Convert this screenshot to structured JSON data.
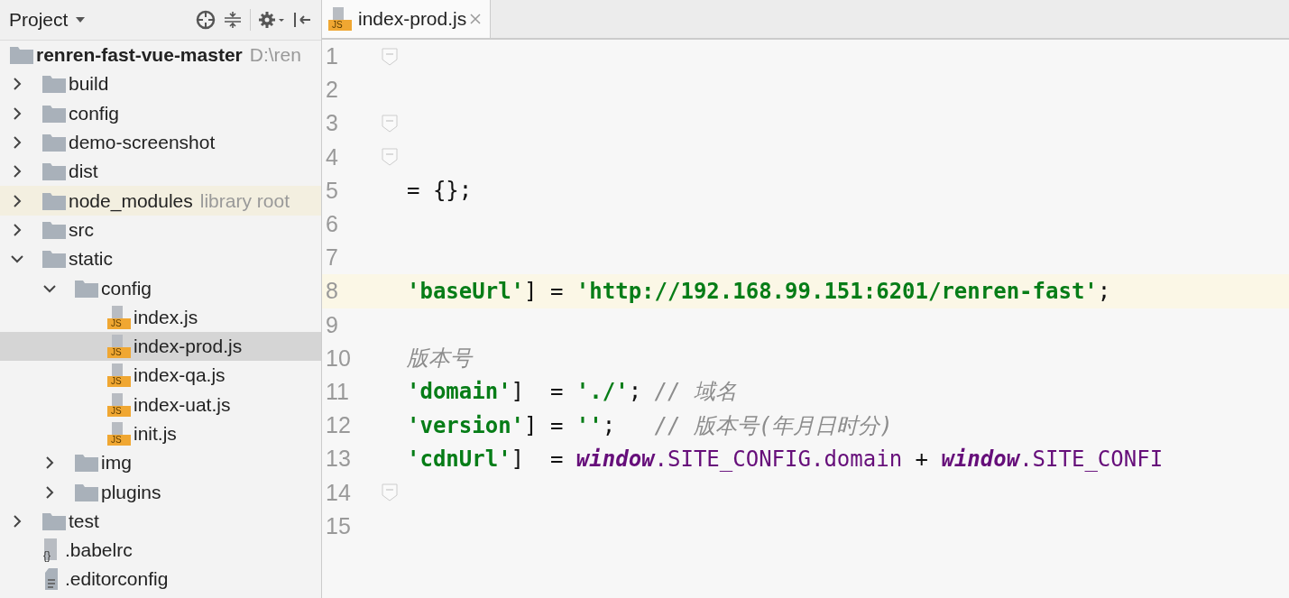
{
  "sidebar": {
    "title": "Project",
    "tree": [
      {
        "name": "renren-fast-vue-master",
        "kind": "root",
        "hint": "D:\\ren",
        "children": [
          {
            "name": "build",
            "kind": "folder",
            "expanded": false
          },
          {
            "name": "config",
            "kind": "folder",
            "expanded": false
          },
          {
            "name": "demo-screenshot",
            "kind": "folder",
            "expanded": false
          },
          {
            "name": "dist",
            "kind": "folder",
            "expanded": false
          },
          {
            "name": "node_modules",
            "kind": "library",
            "hint": "library root",
            "expanded": false
          },
          {
            "name": "src",
            "kind": "folder",
            "expanded": false
          },
          {
            "name": "static",
            "kind": "folder",
            "expanded": true,
            "children": [
              {
                "name": "config",
                "kind": "folder",
                "expanded": true,
                "children": [
                  {
                    "name": "index.js",
                    "kind": "js",
                    "icon_label": "JS",
                    "selected": false
                  },
                  {
                    "name": "index-prod.js",
                    "kind": "js",
                    "icon_label": "JS",
                    "selected": true
                  },
                  {
                    "name": "index-qa.js",
                    "kind": "js",
                    "icon_label": "JS",
                    "selected": false
                  },
                  {
                    "name": "index-uat.js",
                    "kind": "js",
                    "icon_label": "JS",
                    "selected": false
                  },
                  {
                    "name": "init.js",
                    "kind": "js",
                    "icon_label": "JS",
                    "selected": false
                  }
                ]
              },
              {
                "name": "img",
                "kind": "folder",
                "expanded": false
              },
              {
                "name": "plugins",
                "kind": "folder",
                "expanded": false
              }
            ]
          },
          {
            "name": "test",
            "kind": "folder",
            "expanded": false
          },
          {
            "name": ".babelrc",
            "kind": "json",
            "icon_label": "{}"
          },
          {
            "name": ".editorconfig",
            "kind": "text"
          }
        ]
      }
    ]
  },
  "editor": {
    "tab": {
      "label": "index-prod.js",
      "icon_label": "JS",
      "selected": true
    },
    "lines": [
      {
        "number": "1",
        "fold": true,
        "current": false
      },
      {
        "number": "2",
        "fold": false,
        "current": false
      },
      {
        "number": "3",
        "fold": true,
        "current": false
      },
      {
        "number": "4",
        "fold": true,
        "current": false
      },
      {
        "number": "5",
        "fold": false,
        "current": false,
        "tokens": [
          {
            "kind": "plain",
            "text": "= {};"
          }
        ]
      },
      {
        "number": "6",
        "fold": false,
        "current": false
      },
      {
        "number": "7",
        "fold": false,
        "current": false
      },
      {
        "number": "8",
        "fold": false,
        "current": true,
        "tokens": [
          {
            "kind": "string",
            "text": "'baseUrl'"
          },
          {
            "kind": "plain",
            "text": "] = "
          },
          {
            "kind": "string",
            "text": "'http://192.168.99.151:6201/renren-fast'"
          },
          {
            "kind": "plain",
            "text": ";"
          }
        ]
      },
      {
        "number": "9",
        "fold": false,
        "current": false
      },
      {
        "number": "10",
        "fold": false,
        "current": false,
        "tokens": [
          {
            "kind": "comment",
            "text": "版本号"
          }
        ]
      },
      {
        "number": "11",
        "fold": false,
        "current": false,
        "tokens": [
          {
            "kind": "string",
            "text": "'domain'"
          },
          {
            "kind": "plain",
            "text": "]  = "
          },
          {
            "kind": "string",
            "text": "'./'"
          },
          {
            "kind": "plain",
            "text": "; "
          },
          {
            "kind": "comment",
            "text": "// 域名"
          }
        ]
      },
      {
        "number": "12",
        "fold": false,
        "current": false,
        "tokens": [
          {
            "kind": "string",
            "text": "'version'"
          },
          {
            "kind": "plain",
            "text": "] = "
          },
          {
            "kind": "string",
            "text": "''"
          },
          {
            "kind": "plain",
            "text": ";   "
          },
          {
            "kind": "comment",
            "text": "// 版本号(年月日时分)"
          }
        ]
      },
      {
        "number": "13",
        "fold": false,
        "current": false,
        "tokens": [
          {
            "kind": "string",
            "text": "'cdnUrl'"
          },
          {
            "kind": "plain",
            "text": "]  = "
          },
          {
            "kind": "global",
            "text": "window"
          },
          {
            "kind": "field",
            "text": ".SITE_CONFIG.domain"
          },
          {
            "kind": "plain",
            "text": " + "
          },
          {
            "kind": "global",
            "text": "window"
          },
          {
            "kind": "field",
            "text": ".SITE_CONFI"
          }
        ]
      },
      {
        "number": "14",
        "fold": true,
        "current": false
      },
      {
        "number": "15",
        "fold": false,
        "current": false
      }
    ]
  }
}
